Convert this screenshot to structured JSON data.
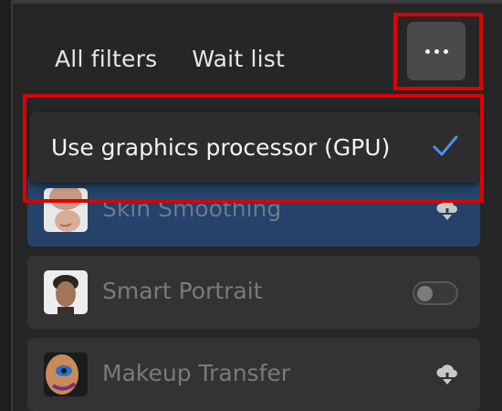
{
  "tabs": [
    {
      "label": "All filters"
    },
    {
      "label": "Wait list"
    }
  ],
  "more_button": {
    "icon": "more-horizontal-icon"
  },
  "menu": {
    "item_label": "Use graphics processor (GPU)",
    "checked": true,
    "check_color": "#4a8ff0"
  },
  "filters": [
    {
      "label": "Skin Smoothing",
      "action_icon": "cloud-download-icon",
      "selected": true
    },
    {
      "label": "Smart Portrait",
      "action_icon": "toggle-icon",
      "enabled": false
    },
    {
      "label": "Makeup Transfer",
      "action_icon": "cloud-download-icon"
    }
  ],
  "colors": {
    "highlight": "#e00000",
    "selected_card": "#24426a"
  }
}
